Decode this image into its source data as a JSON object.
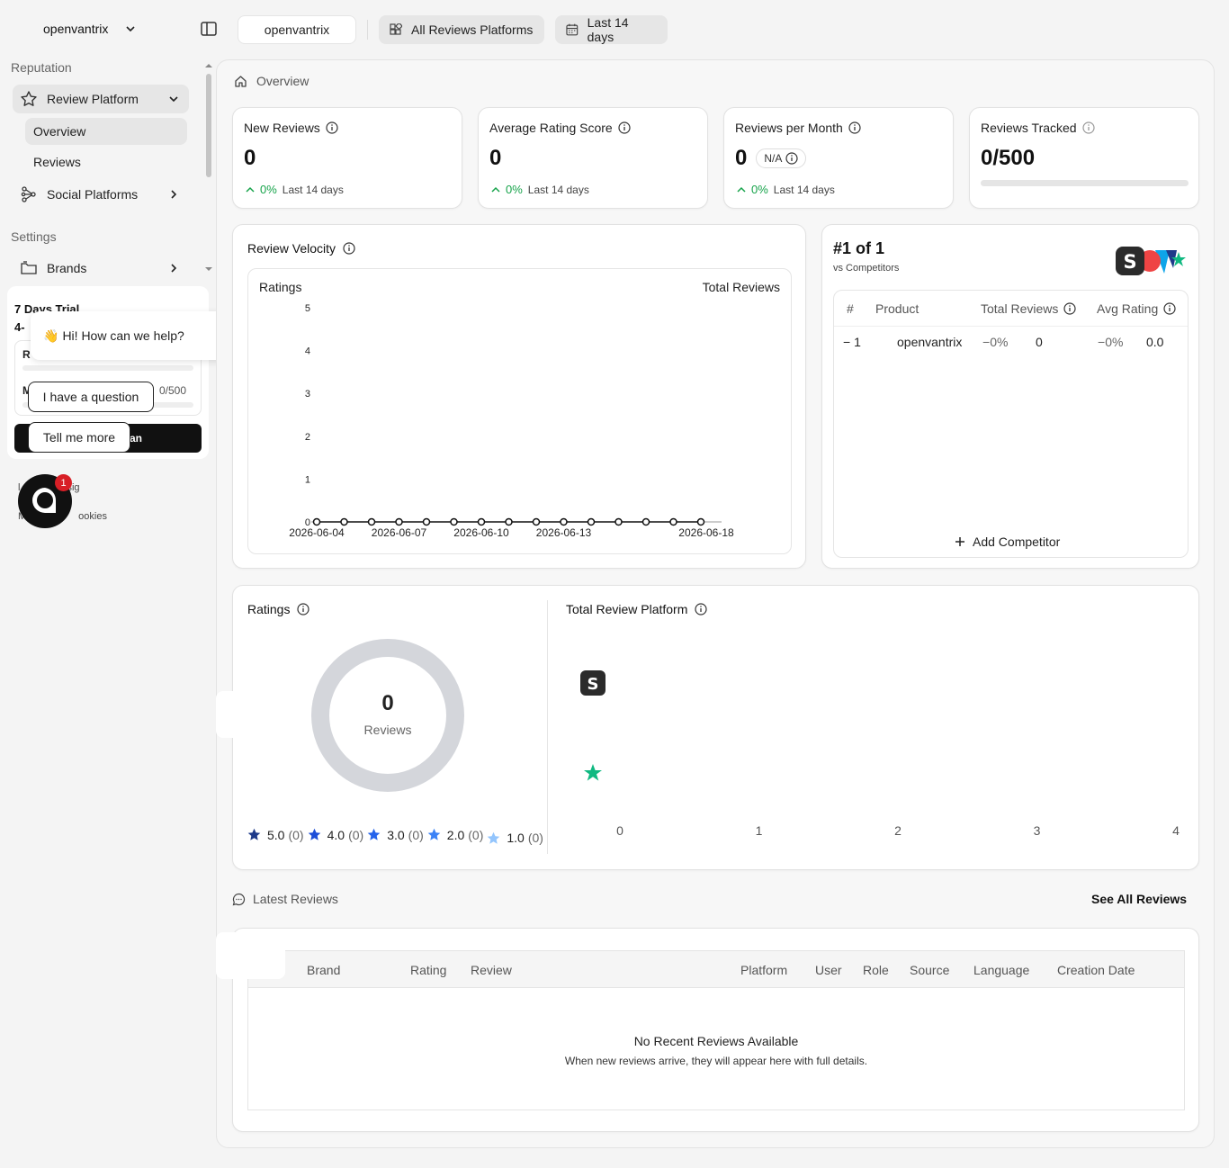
{
  "workspace": {
    "name": "openvantrix"
  },
  "toolbar": {
    "brand": "openvantrix",
    "platforms": "All Reviews Platforms",
    "range": "Last 14 days"
  },
  "sidebar": {
    "section_reputation": "Reputation",
    "review_platform": "Review Platform",
    "overview": "Overview",
    "reviews": "Reviews",
    "social_platforms": "Social Platforms",
    "section_settings": "Settings",
    "brands": "Brands"
  },
  "trial": {
    "title": "7 Days Trial",
    "line2": "4-",
    "r1_label": "R",
    "r2_label": "M",
    "r2_value": "0/500",
    "plan_btn": "an",
    "footer1": "sig",
    "footer2": "ookies",
    "footer1_prefix": "l",
    "footer2_prefix": "M"
  },
  "chat": {
    "greeting_emoji": "👋",
    "greeting": "Hi! How can we help?",
    "option1": "I have a question",
    "option2": "Tell me more",
    "badge": "1"
  },
  "breadcrumb": "Overview",
  "stats": [
    {
      "title": "New Reviews",
      "value": "0",
      "delta": "0%",
      "period": "Last 14 days"
    },
    {
      "title": "Average Rating Score",
      "value": "0",
      "delta": "0%",
      "period": "Last 14 days"
    },
    {
      "title": "Reviews per Month",
      "value": "0",
      "pill": "N/A",
      "delta": "0%",
      "period": "Last 14 days"
    },
    {
      "title": "Reviews Tracked",
      "value": "0/500",
      "progress": 0
    }
  ],
  "velocity": {
    "title": "Review Velocity",
    "left_label": "Ratings",
    "right_label": "Total Reviews"
  },
  "chart_data": {
    "type": "line",
    "title": "Review Velocity",
    "ylabel": "Ratings",
    "y2label": "Total Reviews",
    "ylim": [
      0,
      5
    ],
    "yticks": [
      "0",
      "1",
      "2",
      "3",
      "4",
      "5"
    ],
    "xticks": [
      "2026-06-04",
      "2026-06-07",
      "2026-06-10",
      "2026-06-13",
      "2026-06-18"
    ],
    "x": [
      "2026-06-04",
      "2026-06-05",
      "2026-06-06",
      "2026-06-07",
      "2026-06-08",
      "2026-06-09",
      "2026-06-10",
      "2026-06-11",
      "2026-06-12",
      "2026-06-13",
      "2026-06-14",
      "2026-06-15",
      "2026-06-16",
      "2026-06-17",
      "2026-06-18"
    ],
    "values": [
      0,
      0,
      0,
      0,
      0,
      0,
      0,
      0,
      0,
      0,
      0,
      0,
      0,
      0,
      0
    ],
    "grid": false
  },
  "competitors": {
    "rank": "#1 of 1",
    "subtitle": "vs Competitors",
    "headers": {
      "num": "#",
      "product": "Product",
      "total": "Total Reviews",
      "avg": "Avg Rating"
    },
    "rows": [
      {
        "rank": "1",
        "product": "openvantrix",
        "total_delta": "0%",
        "total": "0",
        "avg_delta": "0%",
        "avg": "0.0"
      }
    ],
    "add": "Add Competitor"
  },
  "ratings": {
    "title": "Ratings",
    "center_value": "0",
    "center_label": "Reviews",
    "legend": [
      {
        "label": "5.0",
        "count": "(0)",
        "color": "#1e3a8a"
      },
      {
        "label": "4.0",
        "count": "(0)",
        "color": "#1d4ed8"
      },
      {
        "label": "3.0",
        "count": "(0)",
        "color": "#2563eb"
      },
      {
        "label": "2.0",
        "count": "(0)",
        "color": "#3b82f6"
      },
      {
        "label": "1.0",
        "count": "(0)",
        "color": "#93c5fd"
      }
    ]
  },
  "platform_chart": {
    "title": "Total Review Platform",
    "type": "bar",
    "categories": [
      "S",
      "Trustpilot"
    ],
    "values": [
      0,
      0
    ],
    "xticks": [
      "0",
      "1",
      "2",
      "3",
      "4"
    ]
  },
  "latest": {
    "title": "Latest Reviews",
    "see_all": "See All Reviews",
    "columns": [
      "Brand",
      "Rating",
      "Review",
      "Platform",
      "User",
      "Role",
      "Source",
      "Language",
      "Creation Date"
    ],
    "empty_title": "No Recent Reviews Available",
    "empty_desc": "When new reviews arrive, they will appear here with full details."
  }
}
